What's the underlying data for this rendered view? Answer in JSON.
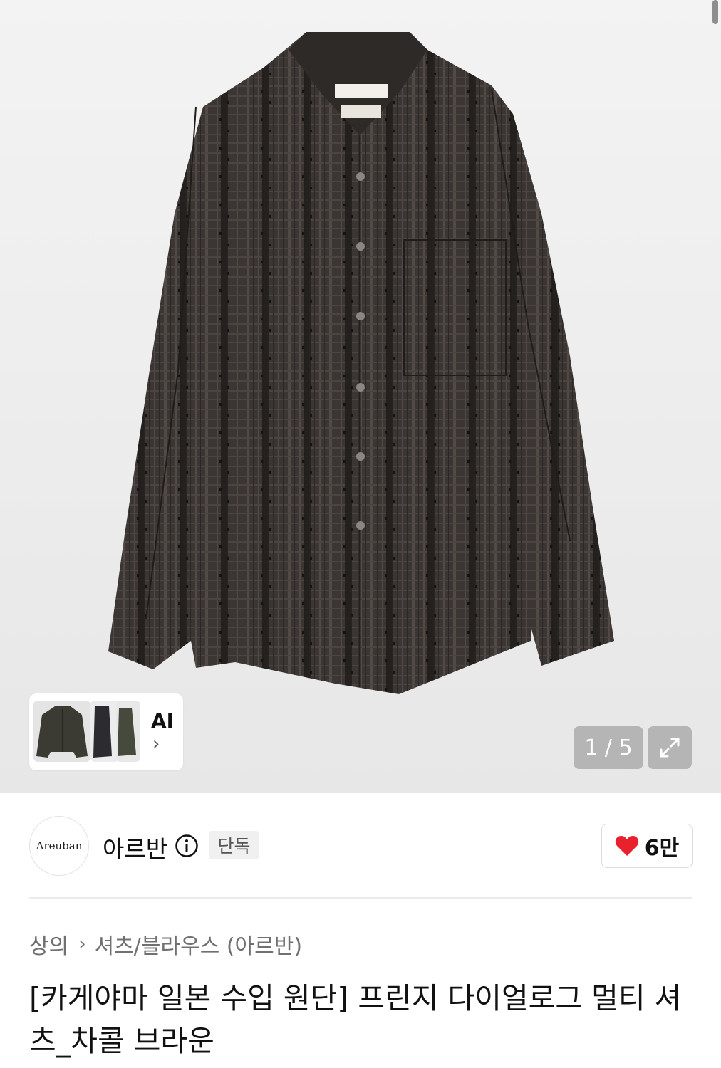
{
  "gallery": {
    "counter": "1 / 5",
    "ai_label": "AI",
    "ai_chevron": "›",
    "expand_icon": "expand-icon"
  },
  "brand": {
    "logo_text": "Areuban",
    "name": "아르반",
    "badge": "단독"
  },
  "like": {
    "count": "6만",
    "heart_color": "#e8212c"
  },
  "breadcrumb": {
    "category": "상의",
    "separator": "›",
    "subcategory": "셔츠/블라우스 (아르반)"
  },
  "product": {
    "title": "[카게야마 일본 수입 원단] 프린지 다이얼로그 멀티 셔츠_차콜 브라운"
  },
  "colors": {
    "shirt": "#3a3531",
    "shirt_stripe": "#1f1c1a",
    "counter_bg": "#b5b5b5"
  }
}
